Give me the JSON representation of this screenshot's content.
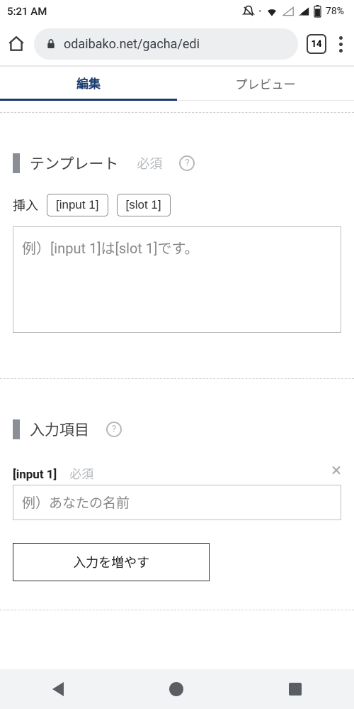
{
  "status": {
    "time": "5:21 AM",
    "battery": "78%"
  },
  "browser": {
    "url": "odaibako.net/gacha/edi",
    "tab_count": "14"
  },
  "tabs": {
    "edit": "編集",
    "preview": "プレビュー"
  },
  "template_section": {
    "title": "テンプレート",
    "required": "必須",
    "insert_label": "挿入",
    "chip_input1": "[input 1]",
    "chip_slot1": "[slot 1]",
    "placeholder": "例）[input 1]は[slot 1]です。"
  },
  "inputs_section": {
    "title": "入力項目",
    "item1": {
      "name": "[input 1]",
      "required": "必須",
      "placeholder": "例）あなたの名前"
    },
    "add_label": "入力を増やす"
  }
}
